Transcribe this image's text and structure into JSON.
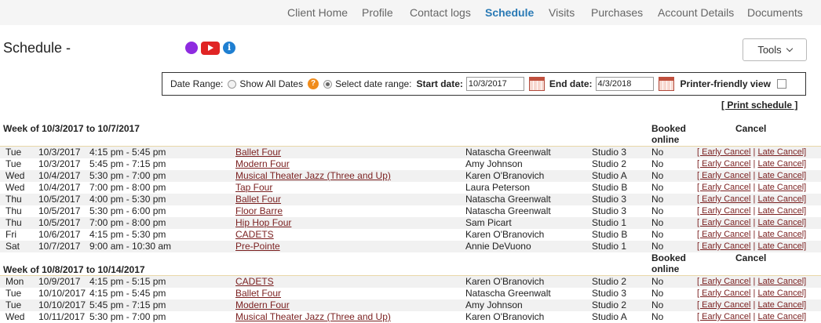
{
  "nav": {
    "tabs": [
      {
        "label": "Client Home"
      },
      {
        "label": "Profile"
      },
      {
        "label": "Contact logs"
      },
      {
        "label": "Schedule",
        "active": true
      },
      {
        "label": "Visits"
      },
      {
        "label": "Purchases"
      },
      {
        "label": "Account Details"
      },
      {
        "label": "Documents"
      }
    ]
  },
  "header": {
    "title": "Schedule -",
    "icons": [
      "purple-circle-icon",
      "youtube-icon",
      "info-icon"
    ],
    "info_glyph": "i",
    "tools_label": "Tools"
  },
  "date_range": {
    "label": "Date Range:",
    "show_all_label": "Show All Dates",
    "help_glyph": "?",
    "select_label": "Select date range:",
    "start_label": "Start date:",
    "start_value": "10/3/2017",
    "end_label": "End date:",
    "end_value": "4/3/2018",
    "printer_label": "Printer-friendly view",
    "selected_option": "Select date range"
  },
  "print_schedule_label": "[ Print schedule ]",
  "columns": {
    "booked_online": "Booked online",
    "cancel": "Cancel"
  },
  "cancel_links": {
    "early": "[ Early Cancel",
    "separator": "|",
    "late": "Late Cancel]"
  },
  "weeks": [
    {
      "label": "Week of 10/3/2017 to 10/7/2017",
      "rows": [
        {
          "day": "Tue",
          "date": "10/3/2017",
          "time": "4:15 pm - 5:45 pm",
          "class": "Ballet Four",
          "teacher": "Natascha Greenwalt",
          "room": "Studio 3",
          "booked": "No"
        },
        {
          "day": "Tue",
          "date": "10/3/2017",
          "time": "5:45 pm - 7:15 pm",
          "class": "Modern Four",
          "teacher": "Amy Johnson",
          "room": "Studio 2",
          "booked": "No"
        },
        {
          "day": "Wed",
          "date": "10/4/2017",
          "time": "5:30 pm - 7:00 pm",
          "class": "Musical Theater Jazz (Three and Up)",
          "teacher": "Karen O'Branovich",
          "room": "Studio A",
          "booked": "No"
        },
        {
          "day": "Wed",
          "date": "10/4/2017",
          "time": "7:00 pm - 8:00 pm",
          "class": "Tap Four",
          "teacher": "Laura Peterson",
          "room": "Studio B",
          "booked": "No"
        },
        {
          "day": "Thu",
          "date": "10/5/2017",
          "time": "4:00 pm - 5:30 pm",
          "class": "Ballet Four",
          "teacher": "Natascha Greenwalt",
          "room": "Studio 3",
          "booked": "No"
        },
        {
          "day": "Thu",
          "date": "10/5/2017",
          "time": "5:30 pm - 6:00 pm",
          "class": "Floor Barre",
          "teacher": "Natascha Greenwalt",
          "room": "Studio 3",
          "booked": "No"
        },
        {
          "day": "Thu",
          "date": "10/5/2017",
          "time": "7:00 pm - 8:00 pm",
          "class": "Hip Hop Four",
          "teacher": "Sam Picart",
          "room": "Studio 1",
          "booked": "No"
        },
        {
          "day": "Fri",
          "date": "10/6/2017",
          "time": "4:15 pm - 5:30 pm",
          "class": "CADETS",
          "teacher": "Karen O'Branovich",
          "room": "Studio B",
          "booked": "No"
        },
        {
          "day": "Sat",
          "date": "10/7/2017",
          "time": "9:00 am - 10:30 am",
          "class": "Pre-Pointe",
          "teacher": "Annie DeVuono",
          "room": "Studio 1",
          "booked": "No"
        }
      ]
    },
    {
      "label": "Week of 10/8/2017 to 10/14/2017",
      "rows": [
        {
          "day": "Mon",
          "date": "10/9/2017",
          "time": "4:15 pm - 5:15 pm",
          "class": "CADETS",
          "teacher": "Karen O'Branovich",
          "room": "Studio 2",
          "booked": "No"
        },
        {
          "day": "Tue",
          "date": "10/10/2017",
          "time": "4:15 pm - 5:45 pm",
          "class": "Ballet Four",
          "teacher": "Natascha Greenwalt",
          "room": "Studio 3",
          "booked": "No"
        },
        {
          "day": "Tue",
          "date": "10/10/2017",
          "time": "5:45 pm - 7:15 pm",
          "class": "Modern Four",
          "teacher": "Amy Johnson",
          "room": "Studio 2",
          "booked": "No"
        },
        {
          "day": "Wed",
          "date": "10/11/2017",
          "time": "5:30 pm - 7:00 pm",
          "class": "Musical Theater Jazz (Three and Up)",
          "teacher": "Karen O'Branovich",
          "room": "Studio A",
          "booked": "No"
        }
      ]
    }
  ]
}
